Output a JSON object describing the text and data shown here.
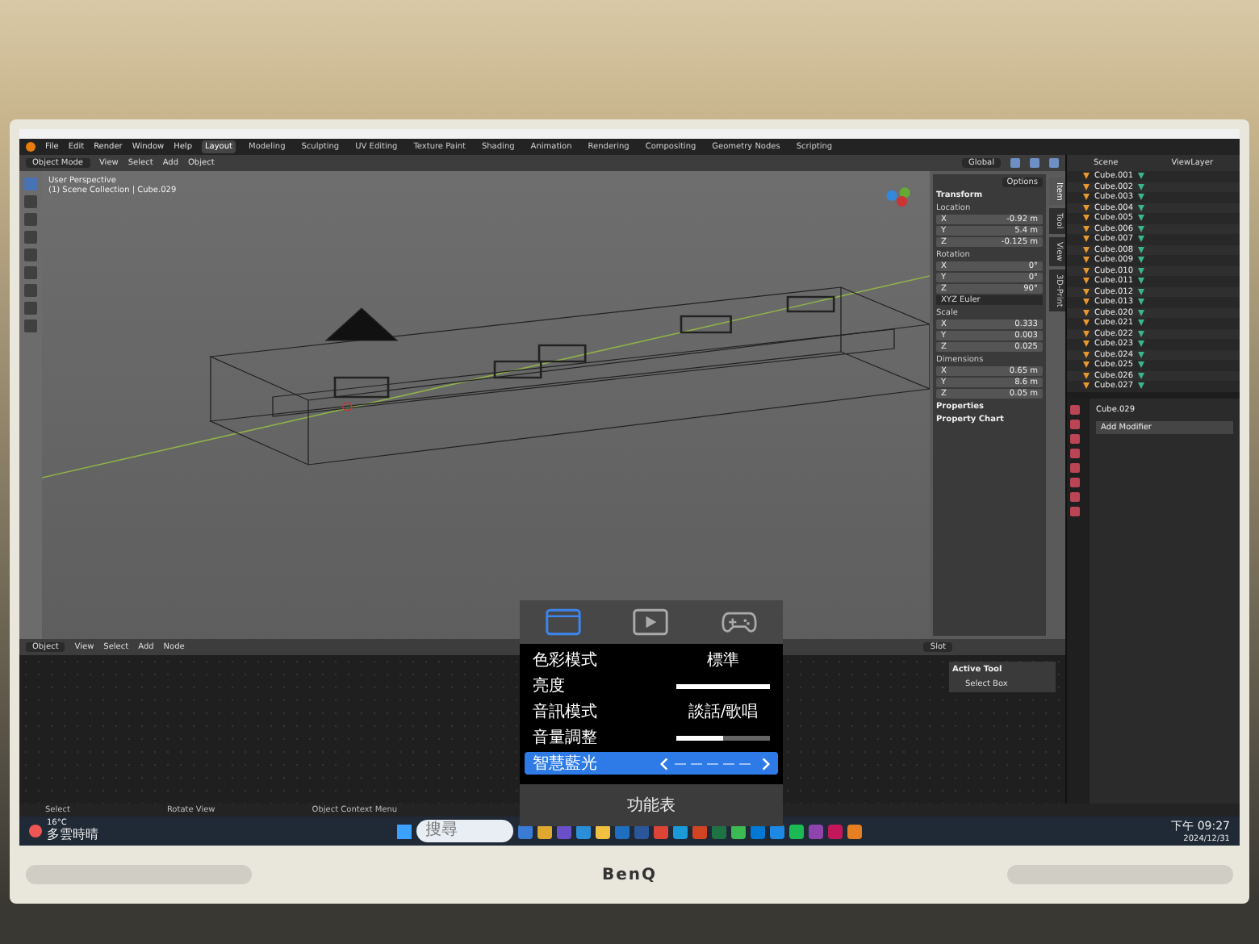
{
  "menu": [
    "File",
    "Edit",
    "Render",
    "Window",
    "Help"
  ],
  "workspace_tabs": [
    {
      "label": "Layout",
      "selected": true
    },
    {
      "label": "Modeling",
      "selected": false
    },
    {
      "label": "Sculpting",
      "selected": false
    },
    {
      "label": "UV Editing",
      "selected": false
    },
    {
      "label": "Texture Paint",
      "selected": false
    },
    {
      "label": "Shading",
      "selected": false
    },
    {
      "label": "Animation",
      "selected": false
    },
    {
      "label": "Rendering",
      "selected": false
    },
    {
      "label": "Compositing",
      "selected": false
    },
    {
      "label": "Geometry Nodes",
      "selected": false
    },
    {
      "label": "Scripting",
      "selected": false
    }
  ],
  "viewport": {
    "header": {
      "mode": "Object Mode",
      "menus": [
        "View",
        "Select",
        "Add",
        "Object"
      ],
      "orientation": "Global",
      "options": "Options"
    },
    "overlay_text": [
      "User Perspective",
      "(1) Scene Collection | Cube.029"
    ],
    "sidebar_tabs": [
      {
        "label": "Item",
        "selected": true
      },
      {
        "label": "Tool",
        "selected": false
      },
      {
        "label": "View",
        "selected": false
      },
      {
        "label": "3D-Print",
        "selected": false
      }
    ],
    "transform": {
      "title": "Transform",
      "groups": [
        {
          "label": "Location",
          "rows": [
            {
              "axis": "X",
              "value": "-0.92 m"
            },
            {
              "axis": "Y",
              "value": "5.4 m"
            },
            {
              "axis": "Z",
              "value": "-0.125 m"
            }
          ]
        },
        {
          "label": "Rotation",
          "rows": [
            {
              "axis": "X",
              "value": "0°"
            },
            {
              "axis": "Y",
              "value": "0°"
            },
            {
              "axis": "Z",
              "value": "90°"
            }
          ],
          "mode": "XYZ Euler"
        },
        {
          "label": "Scale",
          "rows": [
            {
              "axis": "X",
              "value": "0.333"
            },
            {
              "axis": "Y",
              "value": "0.003"
            },
            {
              "axis": "Z",
              "value": "0.025"
            }
          ]
        },
        {
          "label": "Dimensions",
          "rows": [
            {
              "axis": "X",
              "value": "0.65 m"
            },
            {
              "axis": "Y",
              "value": "8.6 m"
            },
            {
              "axis": "Z",
              "value": "0.05 m"
            }
          ]
        }
      ]
    },
    "panels": [
      "Properties",
      "Property Chart"
    ]
  },
  "outliner": {
    "scene": "Scene",
    "view_layer": "ViewLayer",
    "items": [
      "Cube.001",
      "Cube.002",
      "Cube.003",
      "Cube.004",
      "Cube.005",
      "Cube.006",
      "Cube.007",
      "Cube.008",
      "Cube.009",
      "Cube.010",
      "Cube.011",
      "Cube.012",
      "Cube.013",
      "Cube.020",
      "Cube.021",
      "Cube.022",
      "Cube.023",
      "Cube.024",
      "Cube.025",
      "Cube.026",
      "Cube.027"
    ]
  },
  "properties": {
    "object": "Cube.029",
    "button": "Add Modifier"
  },
  "node_editor": {
    "type": "Object",
    "menus": [
      "View",
      "Select",
      "Add",
      "Node"
    ],
    "slot": "Slot",
    "active_tool": {
      "title": "Active Tool",
      "tool": "Select Box"
    }
  },
  "status_bar": [
    "Select",
    "Rotate View",
    "Object Context Menu"
  ],
  "osd": {
    "tabs": [
      {
        "kind": "display",
        "selected": true
      },
      {
        "kind": "video",
        "selected": false
      },
      {
        "kind": "game",
        "selected": false
      }
    ],
    "rows": [
      {
        "kind": "value",
        "label": "色彩模式",
        "value": "標準",
        "selected": false
      },
      {
        "kind": "slider",
        "label": "亮度",
        "level": 1.0,
        "selected": false
      },
      {
        "kind": "value",
        "label": "音訊模式",
        "value": "談話/歌唱",
        "selected": false
      },
      {
        "kind": "slider",
        "label": "音量調整",
        "level": 0.5,
        "selected": false
      },
      {
        "kind": "arrows",
        "label": "智慧藍光",
        "selected": true
      }
    ],
    "footer": "功能表"
  },
  "taskbar": {
    "temperature": "16°C",
    "weather": "多雲時晴",
    "search_placeholder": "搜尋",
    "time": "下午 09:27",
    "date": "2024/12/31"
  },
  "monitor": {
    "brand": "BenQ"
  }
}
